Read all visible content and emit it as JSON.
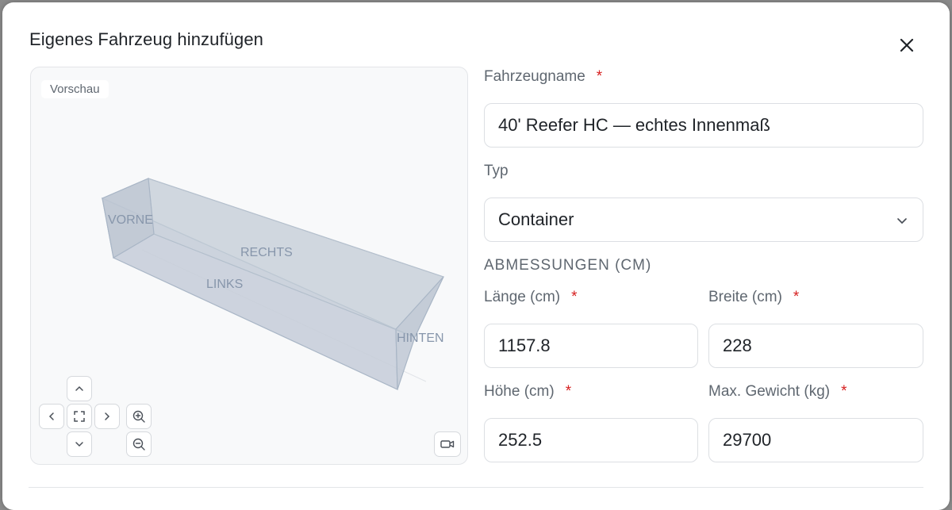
{
  "dialog": {
    "title": "Eigenes Fahrzeug hinzufügen",
    "close_icon": "close-icon"
  },
  "preview": {
    "label": "Vorschau",
    "faces": {
      "front": "VORNE",
      "right": "RECHTS",
      "left": "LINKS",
      "back": "HINTEN"
    },
    "controls": {
      "up_icon": "chevron-up-icon",
      "left_icon": "chevron-left-icon",
      "center_icon": "fit-view-icon",
      "right_icon": "chevron-right-icon",
      "down_icon": "chevron-down-icon",
      "zoom_in_icon": "zoom-in-icon",
      "zoom_out_icon": "zoom-out-icon",
      "camera_icon": "camera-icon"
    }
  },
  "form": {
    "name_label": "Fahrzeugname",
    "name_value": "40' Reefer HC — echtes Innenmaß",
    "type_label": "Typ",
    "type_value": "Container",
    "dimensions_heading": "ABMESSUNGEN (CM)",
    "length_label": "Länge (cm)",
    "length_value": "1157.8",
    "width_label": "Breite (cm)",
    "width_value": "228",
    "height_label": "Höhe (cm)",
    "height_value": "252.5",
    "weight_label": "Max. Gewicht (kg)",
    "weight_value": "29700",
    "required_mark": "*"
  },
  "colors": {
    "required": "#d61f1f",
    "box_fill": "#c9d1dc",
    "box_edge": "#a9b6c6",
    "face_label": "#8796ab"
  }
}
